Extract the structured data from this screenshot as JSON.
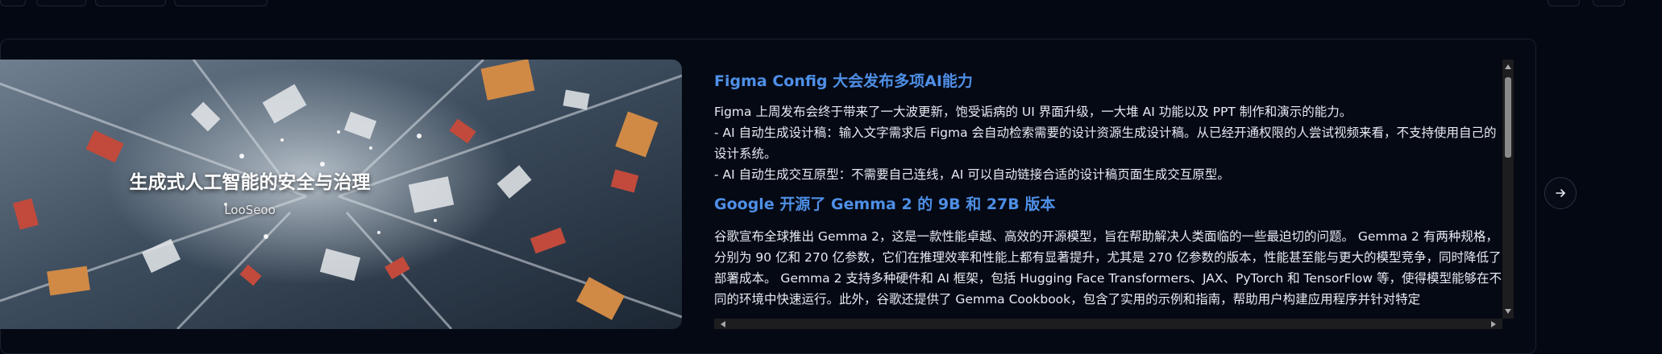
{
  "cover": {
    "title": "生成式人工智能的安全与治理",
    "subtitle": "LooSeoo"
  },
  "article": {
    "sections": [
      {
        "title": "Figma Config 大会发布多项AI能力",
        "paragraphs": [
          "Figma 上周发布会终于带来了一大波更新，饱受诟病的 UI 界面升级，一大堆 AI 功能以及 PPT 制作和演示的能力。",
          "- AI 自动生成设计稿：输入文字需求后 Figma 会自动检索需要的设计资源生成设计稿。从已经开通权限的人尝试视频来看，不支持使用自己的设计系统。",
          "- AI 自动生成交互原型：不需要自己连线，AI 可以自动链接合适的设计稿页面生成交互原型。"
        ]
      },
      {
        "title": "Google 开源了 Gemma 2 的 9B 和 27B 版本",
        "paragraphs": [
          "谷歌宣布全球推出 Gemma 2，这是一款性能卓越、高效的开源模型，旨在帮助解决人类面临的一些最迫切的问题。 Gemma 2 有两种规格，分别为 90 亿和 270 亿参数，它们在推理效率和性能上都有显著提升，尤其是 270 亿参数的版本，性能甚至能与更大的模型竞争，同时降低了部署成本。 Gemma 2 支持多种硬件和 AI 框架，包括 Hugging Face Transformers、JAX、PyTorch 和 TensorFlow 等，使得模型能够在不同的环境中快速运行。此外，谷歌还提供了 Gemma Cookbook，包含了实用的示例和指南，帮助用户构建应用程序并针对特定"
        ]
      }
    ]
  },
  "icons": {
    "next": "arrow-right-icon"
  },
  "colors": {
    "background": "#040813",
    "heading": "#4e8fe6",
    "body_text": "#e8ebf1"
  }
}
